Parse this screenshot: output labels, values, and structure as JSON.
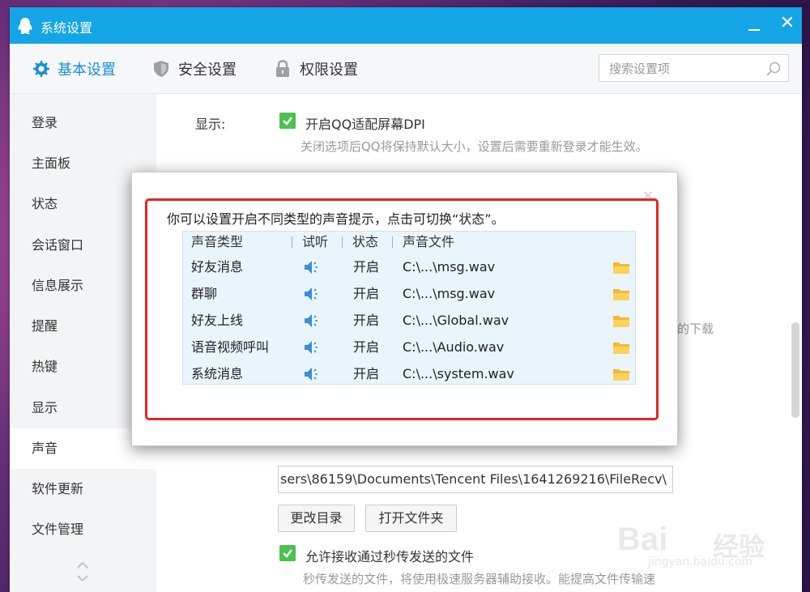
{
  "window": {
    "title": "系统设置"
  },
  "tabs": [
    {
      "label": "基本设置",
      "icon": "gear-icon",
      "active": true
    },
    {
      "label": "安全设置",
      "icon": "shield-icon",
      "active": false
    },
    {
      "label": "权限设置",
      "icon": "lock-icon",
      "active": false
    }
  ],
  "search": {
    "placeholder": "搜索设置项"
  },
  "sidebar": {
    "items": [
      {
        "label": "登录"
      },
      {
        "label": "主面板"
      },
      {
        "label": "状态"
      },
      {
        "label": "会话窗口"
      },
      {
        "label": "信息展示"
      },
      {
        "label": "提醒"
      },
      {
        "label": "热键"
      },
      {
        "label": "显示"
      },
      {
        "label": "声音",
        "active": true
      },
      {
        "label": "软件更新"
      },
      {
        "label": "文件管理"
      }
    ]
  },
  "content": {
    "display_label": "显示:",
    "dpi_checkbox_label": "开启QQ适配屏幕DPI",
    "dpi_hint": "关闭选项后QQ将保持默认大小，设置后需要重新登录才能生效。",
    "download_hint_tail": "的下载",
    "file_path": "sers\\86159\\Documents\\Tencent Files\\1641269216\\FileRecv\\",
    "change_dir_button": "更改目录",
    "open_folder_button": "打开文件夹",
    "recv_checkbox_label": "允许接收通过秒传发送的文件",
    "recv_hint": "秒传发送的文件，将使用极速服务器辅助接收。能提高文件传输速"
  },
  "dialog": {
    "description": "你可以设置开启不同类型的声音提示，点击可切换“状态”。",
    "close_glyph": "×",
    "columns": [
      "声音类型",
      "试听",
      "状态",
      "声音文件"
    ],
    "rows": [
      {
        "type": "好友消息",
        "state": "开启",
        "file": "C:\\...\\msg.wav"
      },
      {
        "type": "群聊",
        "state": "开启",
        "file": "C:\\...\\msg.wav"
      },
      {
        "type": "好友上线",
        "state": "开启",
        "file": "C:\\...\\Global.wav"
      },
      {
        "type": "语音视频呼叫",
        "state": "开启",
        "file": "C:\\...\\Audio.wav"
      },
      {
        "type": "系统消息",
        "state": "开启",
        "file": "C:\\...\\system.wav"
      }
    ]
  },
  "watermark": {
    "brand": "Bai",
    "brand_cn": "经验",
    "url": "jingyan.baidu.com"
  },
  "colors": {
    "titlebar": "#14a5e6",
    "accent": "#1a8fdc",
    "checkbox": "#4dc04d",
    "highlight": "#e8231f"
  }
}
